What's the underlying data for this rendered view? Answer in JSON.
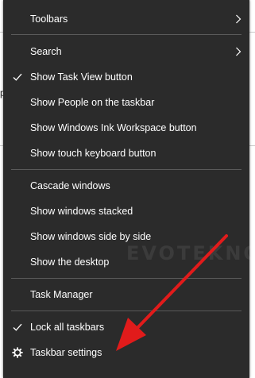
{
  "background": {
    "fragment_text": "p"
  },
  "menu": {
    "watermark": "EVOTEKNO.COM",
    "items": [
      {
        "label": "Toolbars",
        "submenu": true
      },
      {
        "label": "Search",
        "submenu": true
      },
      {
        "label": "Show Task View button",
        "checked": true
      },
      {
        "label": "Show People on the taskbar"
      },
      {
        "label": "Show Windows Ink Workspace button"
      },
      {
        "label": "Show touch keyboard button"
      },
      {
        "label": "Cascade windows"
      },
      {
        "label": "Show windows stacked"
      },
      {
        "label": "Show windows side by side"
      },
      {
        "label": "Show the desktop"
      },
      {
        "label": "Task Manager"
      },
      {
        "label": "Lock all taskbars",
        "checked": true
      },
      {
        "label": "Taskbar settings",
        "icon": "gear-icon"
      }
    ]
  },
  "colors": {
    "menu_background": "#2b2b2b",
    "text": "#ffffff",
    "separator": "#5a5a5a",
    "arrow": "#e11b1b"
  }
}
